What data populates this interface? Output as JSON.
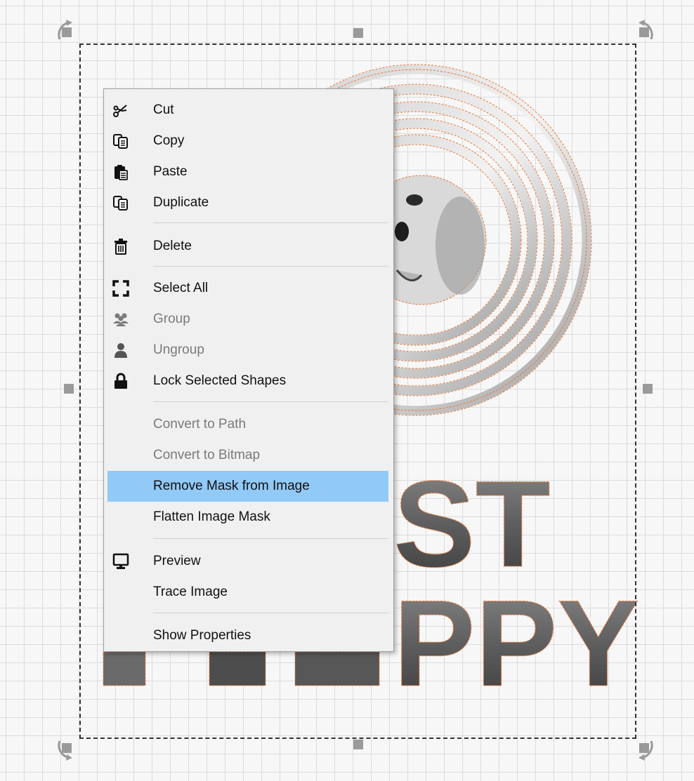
{
  "canvas": {
    "art_text_line1": "ST",
    "art_text_line2": "PPY"
  },
  "menu": {
    "items": [
      {
        "label": "Cut",
        "icon": "scissors-icon",
        "enabled": true
      },
      {
        "label": "Copy",
        "icon": "copy-icon",
        "enabled": true
      },
      {
        "label": "Paste",
        "icon": "paste-icon",
        "enabled": true
      },
      {
        "label": "Duplicate",
        "icon": "duplicate-icon",
        "enabled": true
      },
      {
        "label": "Delete",
        "icon": "trash-icon",
        "enabled": true
      },
      {
        "label": "Select All",
        "icon": "select-all-icon",
        "enabled": true
      },
      {
        "label": "Group",
        "icon": "group-icon",
        "enabled": false
      },
      {
        "label": "Ungroup",
        "icon": "user-icon",
        "enabled": false
      },
      {
        "label": "Lock Selected Shapes",
        "icon": "lock-icon",
        "enabled": true
      },
      {
        "label": "Convert to Path",
        "icon": "",
        "enabled": false
      },
      {
        "label": "Convert to Bitmap",
        "icon": "",
        "enabled": false
      },
      {
        "label": "Remove Mask from Image",
        "icon": "",
        "enabled": true,
        "highlighted": true
      },
      {
        "label": "Flatten Image Mask",
        "icon": "",
        "enabled": true
      },
      {
        "label": "Preview",
        "icon": "monitor-icon",
        "enabled": true
      },
      {
        "label": "Trace Image",
        "icon": "",
        "enabled": true
      },
      {
        "label": "Show Properties",
        "icon": "",
        "enabled": true
      }
    ]
  },
  "colors": {
    "highlight": "#91c9f7",
    "mask_outline": "#e8793a",
    "disabled_text": "#7a7a7a"
  }
}
